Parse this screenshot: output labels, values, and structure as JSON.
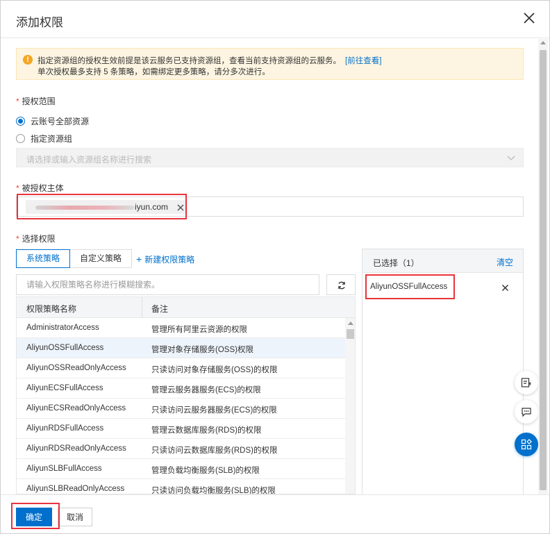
{
  "dialog": {
    "title": "添加权限"
  },
  "alert": {
    "line1": "指定资源组的授权生效前提是该云服务已支持资源组，查看当前支持资源组的云服务。",
    "link": "[前往查看]",
    "line2": "单次授权最多支持 5 条策略，如需绑定更多策略，请分多次进行。"
  },
  "scope": {
    "label": "授权范围",
    "options": [
      {
        "label": "云账号全部资源",
        "checked": true
      },
      {
        "label": "指定资源组",
        "checked": false
      }
    ],
    "resource_group_placeholder": "请选择或输入资源组名称进行搜索"
  },
  "principal": {
    "label": "被授权主体",
    "tag_visible_suffix": "iyun.com"
  },
  "permissions": {
    "label": "选择权限",
    "tabs": [
      "系统策略",
      "自定义策略"
    ],
    "new_policy": "新建权限策略",
    "search_placeholder": "请输入权限策略名称进行模糊搜索。",
    "columns": [
      "权限策略名称",
      "备注"
    ],
    "rows": [
      {
        "name": "AdministratorAccess",
        "note": "管理所有阿里云资源的权限"
      },
      {
        "name": "AliyunOSSFullAccess",
        "note": "管理对象存储服务(OSS)权限"
      },
      {
        "name": "AliyunOSSReadOnlyAccess",
        "note": "只读访问对象存储服务(OSS)的权限"
      },
      {
        "name": "AliyunECSFullAccess",
        "note": "管理云服务器服务(ECS)的权限"
      },
      {
        "name": "AliyunECSReadOnlyAccess",
        "note": "只读访问云服务器服务(ECS)的权限"
      },
      {
        "name": "AliyunRDSFullAccess",
        "note": "管理云数据库服务(RDS)的权限"
      },
      {
        "name": "AliyunRDSReadOnlyAccess",
        "note": "只读访问云数据库服务(RDS)的权限"
      },
      {
        "name": "AliyunSLBFullAccess",
        "note": "管理负载均衡服务(SLB)的权限"
      },
      {
        "name": "AliyunSLBReadOnlyAccess",
        "note": "只读访问负载均衡服务(SLB)的权限"
      }
    ]
  },
  "selected": {
    "title": "已选择（1）",
    "clear": "清空",
    "items": [
      "AliyunOSSFullAccess"
    ]
  },
  "footer": {
    "ok": "确定",
    "cancel": "取消"
  },
  "colors": {
    "primary": "#0070cc",
    "highlight": "#e8333c",
    "alert_bg": "#fdf5e1",
    "alert_icon": "#f5a623"
  }
}
